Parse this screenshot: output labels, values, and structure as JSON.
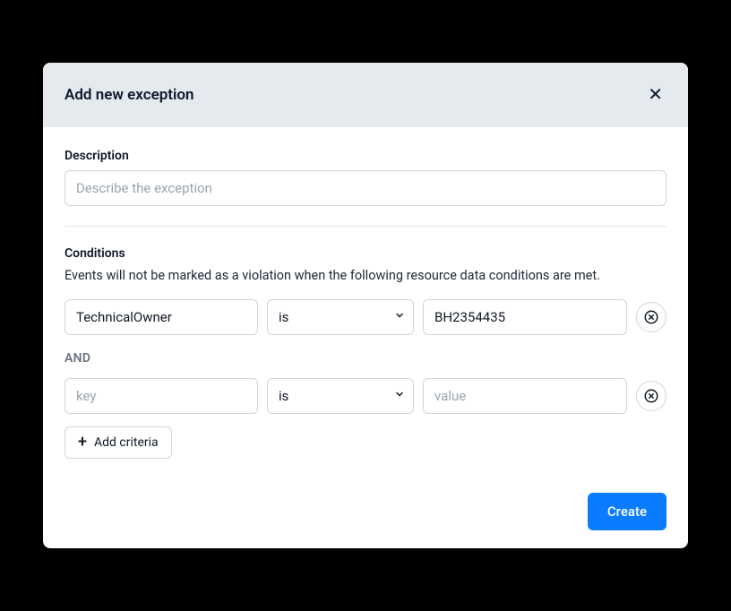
{
  "modal": {
    "title": "Add new exception"
  },
  "description": {
    "label": "Description",
    "placeholder": "Describe the exception",
    "value": ""
  },
  "conditions": {
    "heading": "Conditions",
    "subtext": "Events will not be marked as a violation when the following resource data conditions are met.",
    "and_label": "AND",
    "rows": [
      {
        "key": "TechnicalOwner",
        "key_placeholder": "key",
        "operator": "is",
        "value": "BH2354435",
        "value_placeholder": "value"
      },
      {
        "key": "",
        "key_placeholder": "key",
        "operator": "is",
        "value": "",
        "value_placeholder": "value"
      }
    ]
  },
  "buttons": {
    "add_criteria": "Add criteria",
    "create": "Create"
  },
  "colors": {
    "primary": "#0b7bff",
    "header_bg": "#e5eaef",
    "border": "#d1d5db"
  }
}
